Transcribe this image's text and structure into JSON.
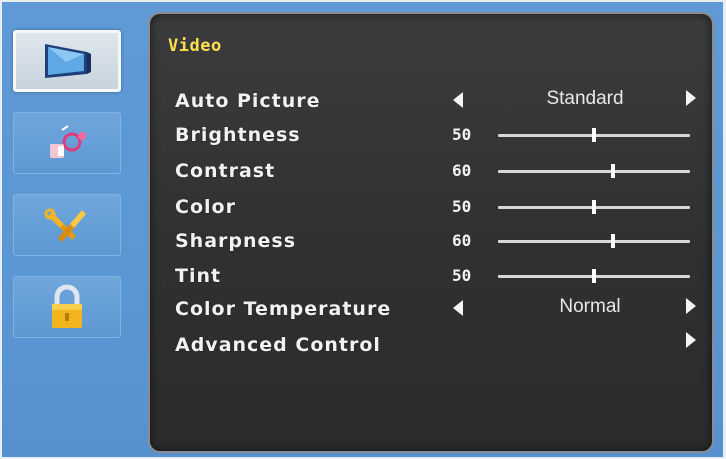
{
  "sidebar": {
    "items": [
      {
        "icon": "monitor-icon",
        "active": true
      },
      {
        "icon": "audio-icon",
        "active": false
      },
      {
        "icon": "tools-icon",
        "active": false
      },
      {
        "icon": "lock-icon",
        "active": false
      }
    ]
  },
  "panel": {
    "title": "Video",
    "auto_picture": {
      "label": "Auto Picture",
      "value": "Standard"
    },
    "brightness": {
      "label": "Brightness",
      "value": "50",
      "level": 50
    },
    "contrast": {
      "label": "Contrast",
      "value": "60",
      "level": 60
    },
    "color": {
      "label": "Color",
      "value": "50",
      "level": 50
    },
    "sharpness": {
      "label": "Sharpness",
      "value": "60",
      "level": 60
    },
    "tint": {
      "label": "Tint",
      "value": "50",
      "level": 50
    },
    "color_temperature": {
      "label": "Color Temperature",
      "value": "Normal"
    },
    "advanced_control": {
      "label": "Advanced Control"
    }
  },
  "colors": {
    "title": "#ffe04a",
    "label": "#f2f2f2",
    "panel_bg": "#333436",
    "backdrop": "#5b97d4"
  }
}
